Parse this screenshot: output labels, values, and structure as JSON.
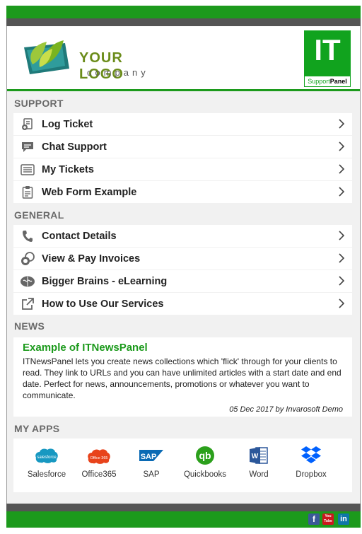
{
  "logo": {
    "main": "YOUR LOGO",
    "sub": "company"
  },
  "badge": {
    "big": "IT",
    "foot_a": "Support",
    "foot_b": "Panel"
  },
  "sections": {
    "support": "SUPPORT",
    "general": "GENERAL",
    "news": "NEWS",
    "apps": "MY APPS"
  },
  "support_items": [
    {
      "label": "Log Ticket",
      "icon": "ticket-add-icon"
    },
    {
      "label": "Chat Support",
      "icon": "chat-icon"
    },
    {
      "label": "My Tickets",
      "icon": "list-icon"
    },
    {
      "label": "Web Form Example",
      "icon": "clipboard-icon"
    }
  ],
  "general_items": [
    {
      "label": "Contact Details",
      "icon": "phone-icon"
    },
    {
      "label": "View & Pay Invoices",
      "icon": "coins-icon"
    },
    {
      "label": "Bigger Brains - eLearning",
      "icon": "brain-icon"
    },
    {
      "label": "How to Use Our Services",
      "icon": "external-link-icon"
    }
  ],
  "news": {
    "title": "Example of ITNewsPanel",
    "body": "ITNewsPanel lets you create news collections which 'flick' through for your clients to read. They link to URLs and you can have unlimited articles with a start date and end date. Perfect for news, announcements, promotions or whatever you want to communicate.",
    "meta": "05 Dec 2017 by Invarosoft Demo"
  },
  "apps": [
    {
      "label": "Salesforce",
      "color": "#1798c1"
    },
    {
      "label": "Office365",
      "color": "#e8431b"
    },
    {
      "label": "SAP",
      "color": "#0a6ab4"
    },
    {
      "label": "Quickbooks",
      "color": "#2ca01c"
    },
    {
      "label": "Word",
      "color": "#2b579a"
    },
    {
      "label": "Dropbox",
      "color": "#0061fe"
    }
  ],
  "social": [
    "f",
    "You Tube",
    "in"
  ],
  "colors": {
    "brand_green": "#1c9a1c",
    "bar_grey": "#555555",
    "panel_bg": "#f1f1f1"
  }
}
